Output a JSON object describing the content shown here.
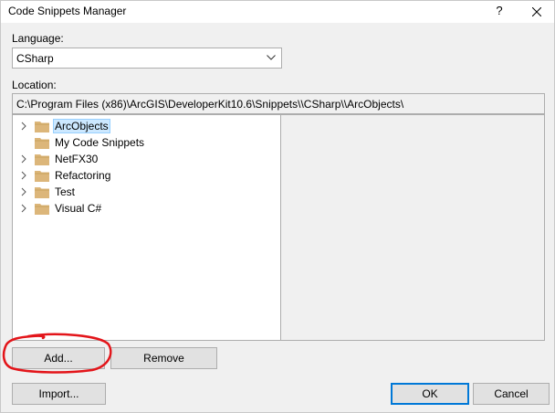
{
  "window": {
    "title": "Code Snippets Manager",
    "help_label": "?"
  },
  "language": {
    "label": "Language:",
    "selected": "CSharp"
  },
  "location": {
    "label": "Location:",
    "path": "C:\\Program Files (x86)\\ArcGIS\\DeveloperKit10.6\\Snippets\\\\CSharp\\\\ArcObjects\\"
  },
  "tree": {
    "items": [
      {
        "label": "ArcObjects",
        "expandable": true,
        "selected": true
      },
      {
        "label": "My Code Snippets",
        "expandable": false,
        "selected": false
      },
      {
        "label": "NetFX30",
        "expandable": true,
        "selected": false
      },
      {
        "label": "Refactoring",
        "expandable": true,
        "selected": false
      },
      {
        "label": "Test",
        "expandable": true,
        "selected": false
      },
      {
        "label": "Visual C#",
        "expandable": true,
        "selected": false
      }
    ]
  },
  "buttons": {
    "add": "Add...",
    "remove": "Remove",
    "import": "Import...",
    "ok": "OK",
    "cancel": "Cancel"
  },
  "colors": {
    "annotation": "#e3151a",
    "folder": "#dcb67a",
    "selection": "#cce8ff",
    "default_button_border": "#0078d7"
  }
}
